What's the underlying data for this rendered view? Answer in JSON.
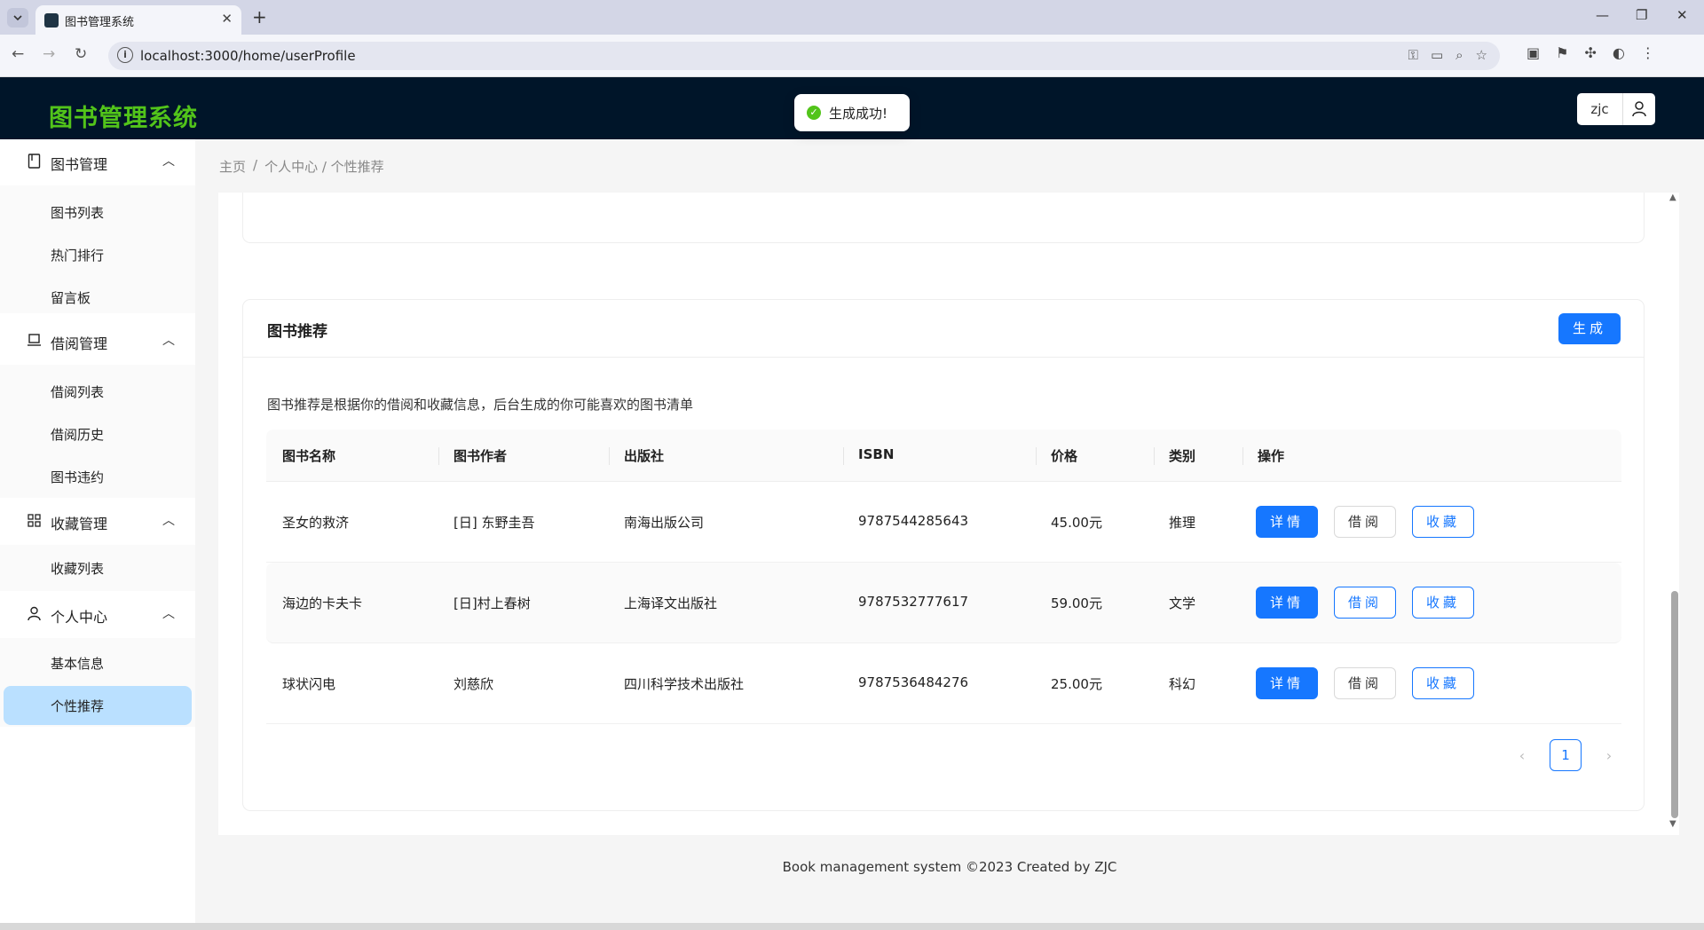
{
  "browser": {
    "tab_title": "图书管理系统",
    "url": "localhost:3000/home/userProfile",
    "new_tab": "+",
    "close_tab": "✕",
    "win_minimize": "—",
    "win_restore": "❐",
    "win_close": "✕"
  },
  "header": {
    "logo": "图书管理系统",
    "username": "zjc"
  },
  "toast": {
    "message": "生成成功!"
  },
  "sidebar": {
    "groups": [
      {
        "label": "图书管理",
        "icon": "book-icon",
        "items": [
          "图书列表",
          "热门排行",
          "留言板"
        ]
      },
      {
        "label": "借阅管理",
        "icon": "laptop-icon",
        "items": [
          "借阅列表",
          "借阅历史",
          "图书违约"
        ]
      },
      {
        "label": "收藏管理",
        "icon": "appstore-icon",
        "items": [
          "收藏列表"
        ]
      },
      {
        "label": "个人中心",
        "icon": "user-icon",
        "items": [
          "基本信息",
          "个性推荐"
        ]
      }
    ],
    "active_item": "个性推荐"
  },
  "breadcrumb": {
    "home": "主页",
    "sep": "/",
    "current": "个人中心 / 个性推荐"
  },
  "recommend": {
    "title": "图书推荐",
    "generate_label": "生成",
    "description": "图书推荐是根据你的借阅和收藏信息，后台生成的你可能喜欢的图书清单",
    "columns": [
      "图书名称",
      "图书作者",
      "出版社",
      "ISBN",
      "价格",
      "类别",
      "操作"
    ],
    "rows": [
      {
        "name": "圣女的救济",
        "author": "[日] 东野圭吾",
        "publisher": "南海出版公司",
        "isbn": "9787544285643",
        "price": "45.00元",
        "category": "推理"
      },
      {
        "name": "海边的卡夫卡",
        "author": "[日]村上春树",
        "publisher": "上海译文出版社",
        "isbn": "9787532777617",
        "price": "59.00元",
        "category": "文学"
      },
      {
        "name": "球状闪电",
        "author": "刘慈欣",
        "publisher": "四川科学技术出版社",
        "isbn": "9787536484276",
        "price": "25.00元",
        "category": "科幻"
      }
    ],
    "actions": {
      "detail": "详情",
      "borrow": "借阅",
      "collect": "收藏"
    },
    "pager": {
      "current_page": "1",
      "prev": "‹",
      "next": "›"
    }
  },
  "footer": {
    "text": "Book management system ©2023 Created by ZJC"
  },
  "colors": {
    "accent": "#1677ff",
    "header_bg": "#001529",
    "logo": "#52c41a",
    "active_menu": "#bae0ff"
  }
}
